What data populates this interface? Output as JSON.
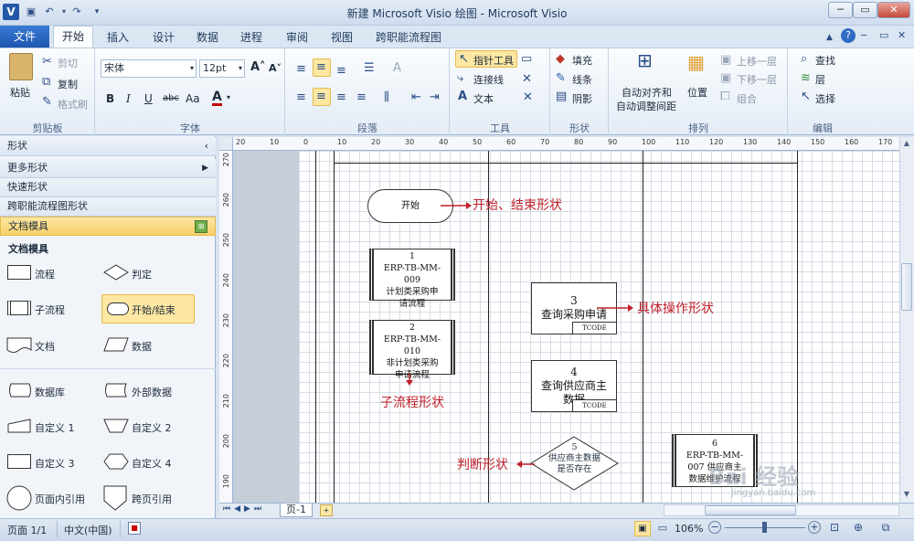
{
  "window": {
    "title": "新建 Microsoft Visio 绘图 - Microsoft Visio",
    "app_icon": "V"
  },
  "ribbon_tabs": {
    "file": "文件",
    "items": [
      "开始",
      "插入",
      "设计",
      "数据",
      "进程",
      "审阅",
      "视图",
      "跨职能流程图"
    ]
  },
  "clipboard": {
    "paste": "粘贴",
    "cut": "剪切",
    "copy": "复制",
    "format_painter": "格式刷",
    "label": "剪贴板"
  },
  "font": {
    "name": "宋体",
    "size": "12pt",
    "label": "字体",
    "bold": "B",
    "italic": "I",
    "underline": "U",
    "strike": "abc",
    "case": "Aa"
  },
  "paragraph": {
    "label": "段落"
  },
  "tools": {
    "pointer": "指针工具",
    "connector": "连接线",
    "text": "文本",
    "label": "工具"
  },
  "shape": {
    "fill": "填充",
    "line": "线条",
    "shadow": "阴影",
    "label": "形状"
  },
  "arrange": {
    "auto_align": "自动对齐和",
    "auto_space": "自动调整间距",
    "position": "位置",
    "bring_forward": "上移一层",
    "send_backward": "下移一层",
    "group": "组合",
    "label": "排列"
  },
  "edit": {
    "find": "查找",
    "layer": "层",
    "select": "选择",
    "label": "编辑"
  },
  "shapes_panel": {
    "header": "形状",
    "sections": [
      "更多形状",
      "快速形状",
      "跨职能流程图形状",
      "文档模具"
    ],
    "stencil_title": "文档模具",
    "items": [
      "流程",
      "判定",
      "子流程",
      "开始/结束",
      "文档",
      "数据",
      "数据库",
      "外部数据",
      "自定义 1",
      "自定义 2",
      "自定义 3",
      "自定义 4",
      "页面内引用",
      "跨页引用"
    ]
  },
  "hruler_labels": [
    "20",
    "10",
    "0",
    "10",
    "20",
    "30",
    "40",
    "50",
    "60",
    "70",
    "80",
    "90",
    "100",
    "110",
    "120",
    "130",
    "140",
    "150",
    "160",
    "170"
  ],
  "vruler_labels": [
    "270",
    "260",
    "250",
    "240",
    "230",
    "220",
    "210",
    "200",
    "190"
  ],
  "diagram": {
    "start": "开始",
    "sub1": {
      "num": "1",
      "l1": "ERP-TB-MM-",
      "l2": "009",
      "l3": "计划类采购申",
      "l4": "请流程"
    },
    "sub2": {
      "num": "2",
      "l1": "ERP-TB-MM-",
      "l2": "010",
      "l3": "非计划类采购",
      "l4": "申请流程"
    },
    "proc3": {
      "num": "3",
      "text": "查询采购申请",
      "code": "TCODE"
    },
    "proc4": {
      "num": "4",
      "text1": "查询供应商主",
      "text2": "数据",
      "code": "TCODE"
    },
    "dec5": {
      "num": "5",
      "text1": "供应商主数据",
      "text2": "是否存在"
    },
    "sub6": {
      "num": "6",
      "l1": "ERP-TB-MM-",
      "l2": "007  供应商主",
      "l3": "数据维护流程"
    },
    "annotations": {
      "start_end": "开始、结束形状",
      "process": "具体操作形状",
      "subprocess": "子流程形状",
      "decision": "判断形状"
    }
  },
  "page_tabs": {
    "page": "页-1"
  },
  "status": {
    "page": "页面 1/1",
    "lang": "中文(中国)",
    "zoom": "106%"
  },
  "watermark": {
    "text": "Bai 经验",
    "url": "jingyan.baidu.com"
  },
  "colors": {
    "accent": "#2457a6",
    "annotation": "#c0202a",
    "highlight": "#fde7a2"
  }
}
